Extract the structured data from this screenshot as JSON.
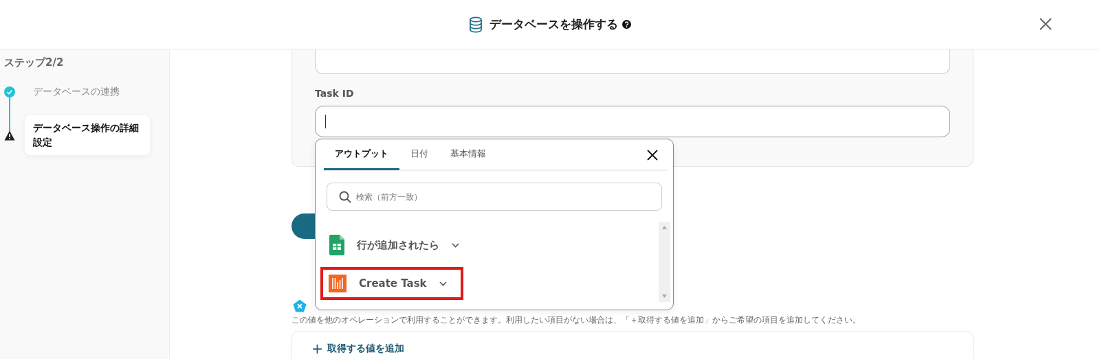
{
  "header": {
    "title": "データベースを操作する"
  },
  "sidebar": {
    "step_label": "ステップ2/2",
    "steps": [
      {
        "label": "データベースの連携",
        "kind": "done",
        "selected": false
      },
      {
        "label": "データベース操作の詳細設定",
        "kind": "warning",
        "selected": true
      }
    ]
  },
  "form": {
    "field_label": "Task ID"
  },
  "popup": {
    "tabs": [
      {
        "label": "アウトプット",
        "selected": true
      },
      {
        "label": "日付",
        "selected": false
      },
      {
        "label": "基本情報",
        "selected": false
      }
    ],
    "search": {
      "placeholder": "検索（前方一致）"
    },
    "items": [
      {
        "label": "行が追加されたら",
        "kind": "sheet",
        "highlighted": false
      },
      {
        "label": "Create Task",
        "kind": "bars",
        "highlighted": true
      }
    ]
  },
  "output_section": {
    "description": "この値を他のオペレーションで利用することができます。利用したい項目がない場合は、「＋取得する値を追加」からご希望の項目を追加してください。",
    "add_button": "取得する値を追加"
  }
}
